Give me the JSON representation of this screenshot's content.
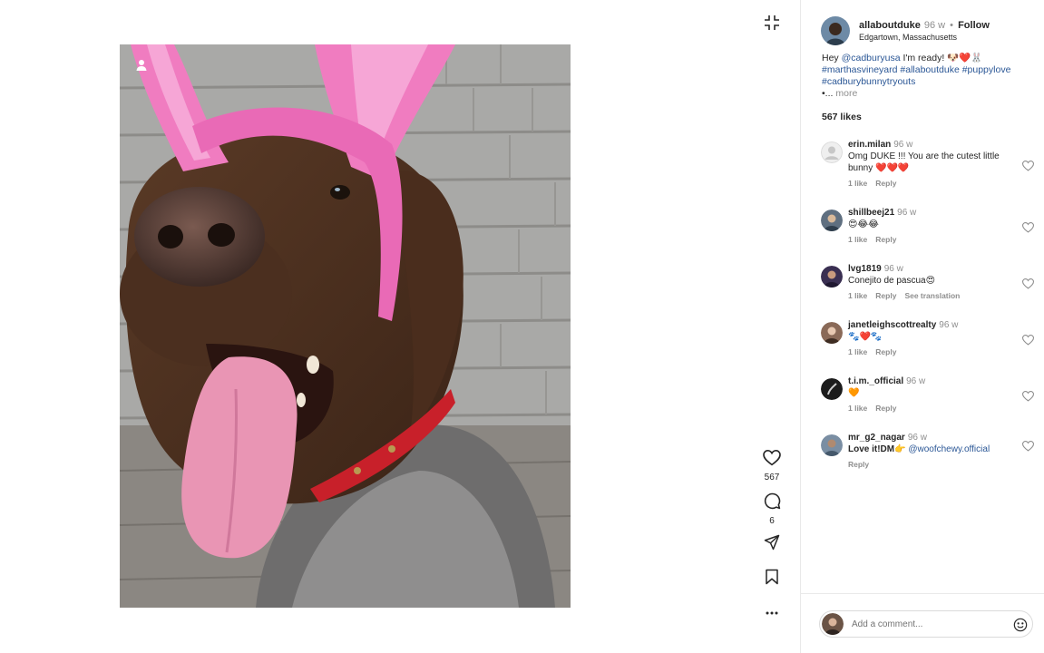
{
  "post": {
    "username": "allaboutduke",
    "time": "96 w",
    "separator": "•",
    "follow_label": "Follow",
    "location": "Edgartown, Massachusetts",
    "caption": {
      "greeting": "Hey ",
      "mention": "@cadburyusa",
      "text": " I'm ready! 🐶❤️🐰",
      "hashtags": [
        "#marthasvineyard",
        "#allaboutduke",
        "#puppylove",
        "#cadburybunnytryouts"
      ],
      "ellipsis": "•... ",
      "more_label": "more"
    },
    "likes_label": "567 likes"
  },
  "rail": {
    "like_count": "567",
    "comment_count": "6"
  },
  "comments": [
    {
      "user": "erin.milan",
      "time": "96 w",
      "text": "Omg DUKE !!! You are the cutest little bunny ❤️❤️❤️",
      "likes": "1 like",
      "reply": "Reply",
      "avatar_color": "#d9d9d9"
    },
    {
      "user": "shillbeej21",
      "time": "96 w",
      "text": "😍😂😂",
      "likes": "1 like",
      "reply": "Reply",
      "avatar_color": "#5f6f80"
    },
    {
      "user": "lvg1819",
      "time": "96 w",
      "text": "Conejito de pascua😍",
      "likes": "1 like",
      "reply": "Reply",
      "translation": "See translation",
      "avatar_color": "#3a2f52"
    },
    {
      "user": "janetleighscottrealty",
      "time": "96 w",
      "text": "🐾❤️🐾",
      "likes": "1 like",
      "reply": "Reply",
      "avatar_color": "#8a6a58"
    },
    {
      "user": "t.i.m._official",
      "time": "96 w",
      "text": "🧡",
      "likes": "1 like",
      "reply": "Reply",
      "avatar_color": "#1c1c1c"
    },
    {
      "user": "mr_g2_nagar",
      "time": "96 w",
      "text_bold": "Love it!DM👉 ",
      "mention": "@woofchewy.official",
      "reply": "Reply",
      "avatar_color": "#7a8ea3"
    }
  ],
  "composer": {
    "placeholder": "Add a comment..."
  },
  "icons": {
    "collapse": "collapse-icon",
    "tag": "user-tag-icon",
    "like": "heart-icon",
    "comment": "comment-icon",
    "share": "paper-plane-icon",
    "save": "bookmark-icon",
    "more": "more-icon",
    "emoji": "emoji-icon"
  },
  "colors": {
    "link": "#2b5796",
    "muted": "#8e8e8e",
    "text": "#262626"
  }
}
